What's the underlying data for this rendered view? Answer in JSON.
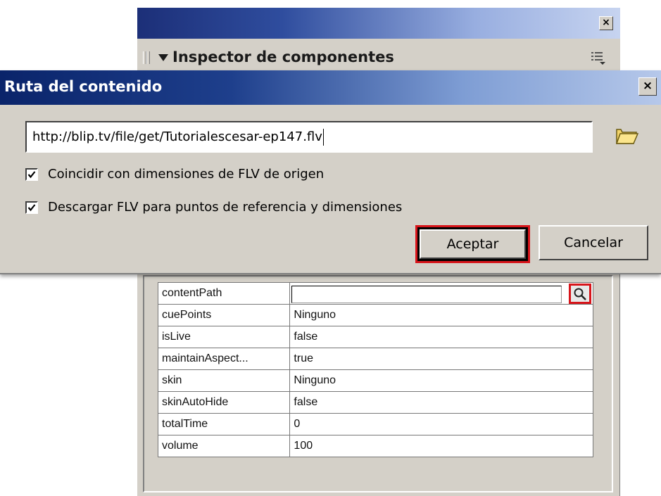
{
  "inspector": {
    "title": "Inspector de componentes",
    "close_glyph": "×",
    "icons": [
      "close-icon",
      "panel-menu-icon",
      "collapse-arrow-icon",
      "search-icon"
    ],
    "properties": [
      {
        "name": "contentPath",
        "value": ""
      },
      {
        "name": "cuePoints",
        "value": "Ninguno"
      },
      {
        "name": "isLive",
        "value": "false"
      },
      {
        "name": "maintainAspect...",
        "value": "true"
      },
      {
        "name": "skin",
        "value": "Ninguno"
      },
      {
        "name": "skinAutoHide",
        "value": "false"
      },
      {
        "name": "totalTime",
        "value": "0"
      },
      {
        "name": "volume",
        "value": "100"
      }
    ]
  },
  "dialog": {
    "title": "Ruta del contenido",
    "close_glyph": "×",
    "path_value": "http://blip.tv/file/get/Tutorialescesar-ep147.flv",
    "icons": [
      "folder-icon",
      "close-icon",
      "checkmark-icon"
    ],
    "checkboxes": [
      {
        "label": "Coincidir con dimensiones de FLV de origen",
        "checked": true
      },
      {
        "label": "Descargar FLV para puntos de referencia y dimensiones",
        "checked": true
      }
    ],
    "accept_label": "Aceptar",
    "cancel_label": "Cancelar"
  },
  "colors": {
    "highlight": "#d7141a",
    "panel_bg": "#d4d0c8",
    "titlebar_dark": "#0a246a"
  }
}
